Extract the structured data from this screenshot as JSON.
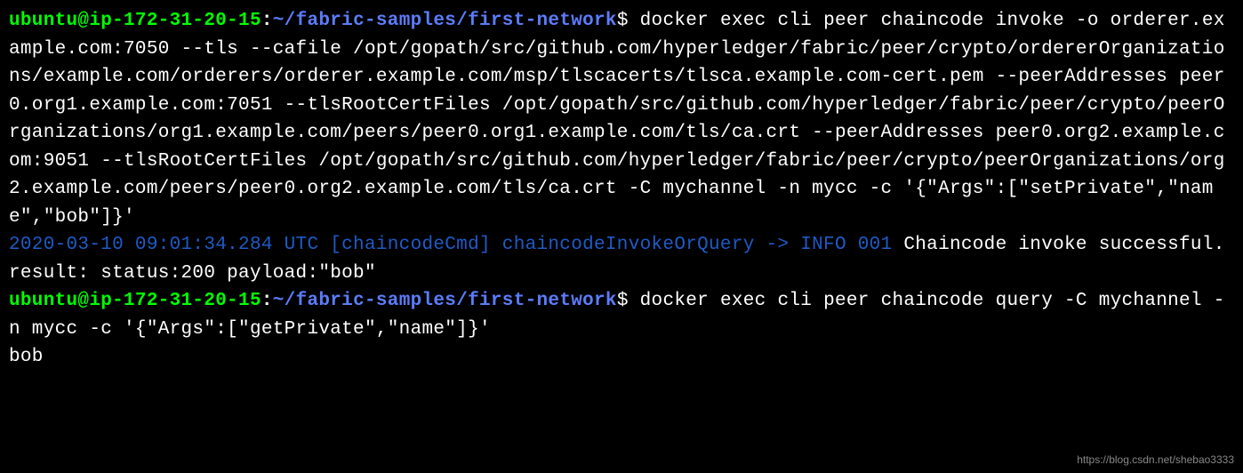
{
  "prompt1": {
    "user_host": "ubuntu@ip-172-31-20-15",
    "separator": ":",
    "path": "~/fabric-samples/first-network",
    "dollar": "$"
  },
  "command1": " docker exec cli peer chaincode invoke -o orderer.example.com:7050 --tls --cafile /opt/gopath/src/github.com/hyperledger/fabric/peer/crypto/ordererOrganizations/example.com/orderers/orderer.example.com/msp/tlscacerts/tlsca.example.com-cert.pem --peerAddresses peer0.org1.example.com:7051 --tlsRootCertFiles /opt/gopath/src/github.com/hyperledger/fabric/peer/crypto/peerOrganizations/org1.example.com/peers/peer0.org1.example.com/tls/ca.crt --peerAddresses peer0.org2.example.com:9051 --tlsRootCertFiles /opt/gopath/src/github.com/hyperledger/fabric/peer/crypto/peerOrganizations/org2.example.com/peers/peer0.org2.example.com/tls/ca.crt -C mychannel -n mycc -c '{\"Args\":[\"setPrivate\",\"name\",\"bob\"]}'",
  "output1": {
    "log_prefix": "2020-03-10 09:01:34.284 UTC [chaincodeCmd] chaincodeInvokeOrQuery -> INFO 001",
    "log_message": " Chaincode invoke successful. result: status:200 payload:\"bob\""
  },
  "prompt2": {
    "user_host": "ubuntu@ip-172-31-20-15",
    "separator": ":",
    "path": "~/fabric-samples/first-network",
    "dollar": "$"
  },
  "command2": " docker exec cli peer chaincode query -C mychannel -n mycc -c '{\"Args\":[\"getPrivate\",\"name\"]}'",
  "output2": "bob",
  "watermark": "https://blog.csdn.net/shebao3333"
}
